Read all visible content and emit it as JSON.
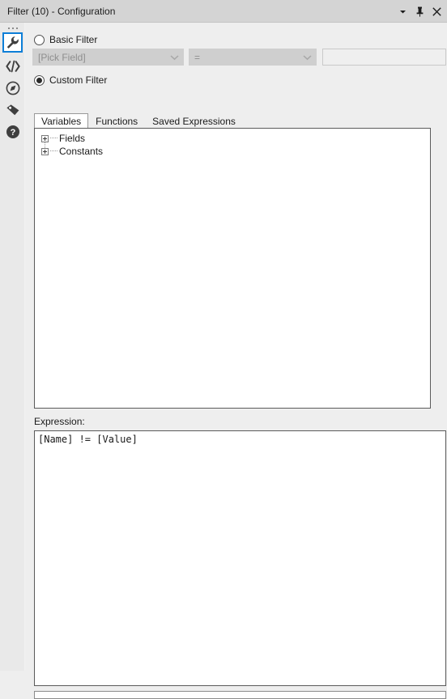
{
  "window": {
    "title": "Filter (10) - Configuration",
    "buttons": [
      {
        "name": "window-menu-chevron",
        "icon": "chevron-down-icon",
        "label": "▾"
      },
      {
        "name": "auto-hide-pin",
        "icon": "pin-icon",
        "label": "Auto Hide"
      },
      {
        "name": "close-window",
        "icon": "close-icon",
        "label": "Close"
      }
    ]
  },
  "rail": {
    "overflow_label": "...",
    "items": [
      {
        "name": "configuration-tool",
        "icon": "wrench-icon",
        "selected": true
      },
      {
        "name": "xml-view",
        "icon": "code-icon",
        "selected": false
      },
      {
        "name": "engine-view",
        "icon": "compass-icon",
        "selected": false
      },
      {
        "name": "annotation-view",
        "icon": "tag-icon",
        "selected": false
      },
      {
        "name": "help-view",
        "icon": "help-icon",
        "selected": false
      }
    ]
  },
  "filter": {
    "basic": {
      "label": "Basic Filter",
      "checked": false,
      "field_placeholder": "[Pick Field]",
      "operator_value": "=",
      "value_text": ""
    },
    "custom": {
      "label": "Custom Filter",
      "checked": true
    }
  },
  "tabs": [
    {
      "label": "Variables",
      "active": true
    },
    {
      "label": "Functions",
      "active": false
    },
    {
      "label": "Saved Expressions",
      "active": false
    }
  ],
  "tree": {
    "nodes": [
      {
        "label": "Fields",
        "expanded": false
      },
      {
        "label": "Constants",
        "expanded": false
      }
    ]
  },
  "expression": {
    "label": "Expression:",
    "value": "[Name] != [Value]"
  },
  "colors": {
    "accent": "#0c7ed7",
    "titlebar": "#d4d4d4",
    "background": "#eeeeee",
    "panel": "#ffffff"
  }
}
